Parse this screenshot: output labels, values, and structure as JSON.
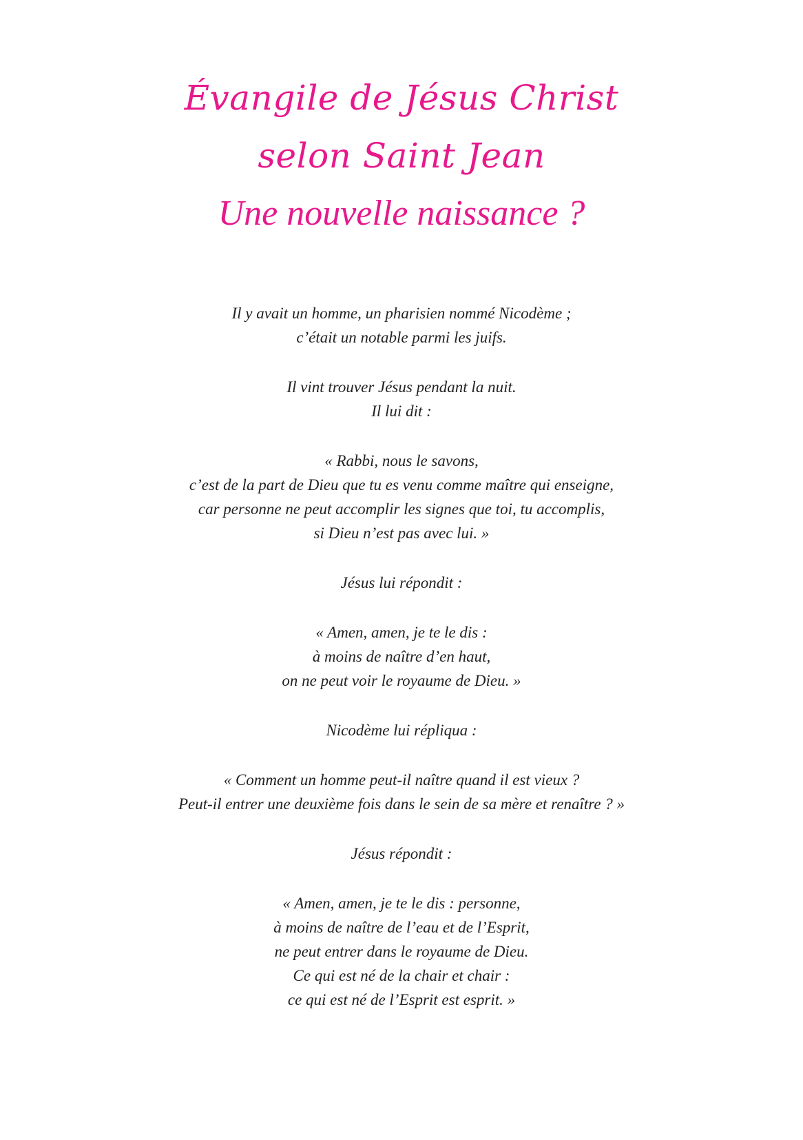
{
  "document": {
    "title_lines": [
      "Évangile de Jésus Christ",
      "selon Saint Jean",
      "Une nouvelle naissance ?"
    ],
    "stanzas": [
      [
        "Il y avait un homme, un pharisien nommé Nicodème ;",
        "c’était un notable parmi les juifs."
      ],
      [
        "Il vint trouver Jésus pendant la nuit.",
        "Il lui dit :"
      ],
      [
        "« Rabbi, nous le savons,",
        "c’est de la part de Dieu que tu es venu comme maître qui enseigne,",
        "car personne ne peut accomplir les signes que toi, tu accomplis,",
        "si Dieu n’est pas avec lui. »"
      ],
      [
        "Jésus lui répondit :"
      ],
      [
        "« Amen, amen, je te le dis :",
        "à moins de naître d’en haut,",
        "on ne peut voir le royaume de Dieu. »"
      ],
      [
        "Nicodème lui répliqua :"
      ],
      [
        "« Comment un homme peut-il naître quand il est vieux ?",
        "Peut-il entrer une deuxième fois dans le sein de sa mère et renaître ? »"
      ],
      [
        "Jésus répondit :"
      ],
      [
        "« Amen, amen, je te le dis : personne,",
        "à moins de naître de l’eau et de l’Esprit,",
        "ne peut entrer dans le royaume de Dieu.",
        "Ce qui est né de la chair et chair :",
        "ce qui est né de l’Esprit est esprit. »"
      ]
    ]
  },
  "colors": {
    "title": "#e6198c",
    "body": "#222222",
    "background": "#ffffff"
  }
}
